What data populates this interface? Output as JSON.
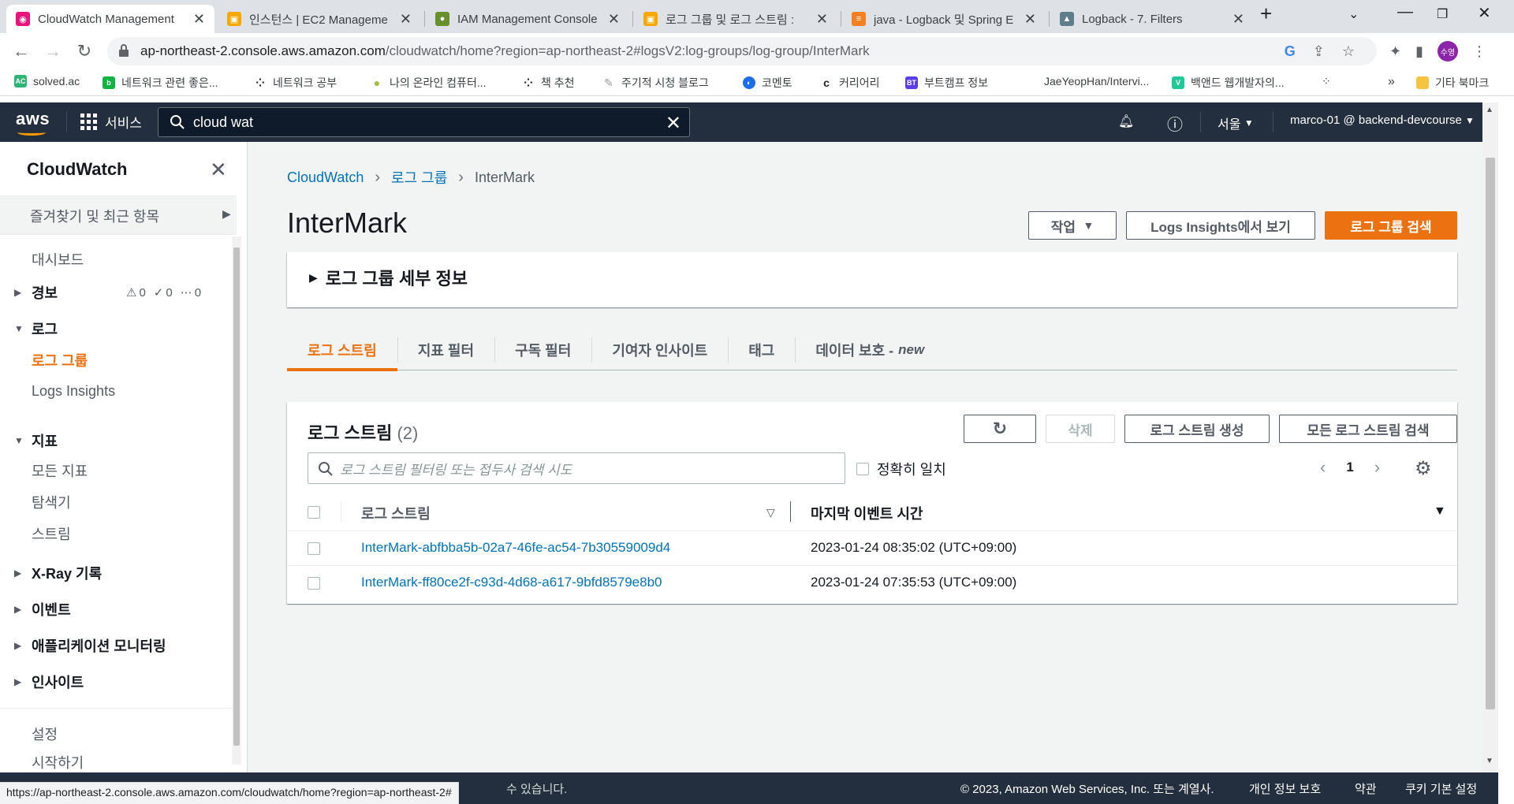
{
  "browser": {
    "tabs": [
      {
        "title": "CloudWatch Management",
        "active": true,
        "color": "#e7157b"
      },
      {
        "title": "인스턴스 | EC2 Manageme",
        "active": false,
        "color": "#f7a800"
      },
      {
        "title": "IAM Management Console",
        "active": false,
        "color": "#6a8f2e"
      },
      {
        "title": "로그 그룹 및 로그 스트림 :",
        "active": false,
        "color": "#f7a800"
      },
      {
        "title": "java - Logback 및 Spring E",
        "active": false,
        "color": "#f48024"
      },
      {
        "title": "Logback - 7. Filters",
        "active": false,
        "color": "#607d8b"
      }
    ],
    "url_host": "ap-northeast-2.console.aws.amazon.com",
    "url_path": "/cloudwatch/home?region=ap-northeast-2#logsV2:log-groups/log-group/InterMark",
    "profile_initial": "수영",
    "bookmarks": [
      {
        "label": "solved.ac",
        "color": "#2bb673",
        "icon": "AC"
      },
      {
        "label": "네트워크 관련 좋은...",
        "color": "#11b343",
        "icon": "b"
      },
      {
        "label": "네트워크 공부",
        "color": "#222222",
        "icon": "⁘"
      },
      {
        "label": "나의 온라인 컴퓨터...",
        "color": "#9ac43c",
        "icon": "●"
      },
      {
        "label": "책 추천",
        "color": "#222222",
        "icon": "⁘"
      },
      {
        "label": "주기적 시청 블로그",
        "color": "#999999",
        "icon": "✎"
      },
      {
        "label": "코멘토",
        "color": "#1c6ee8",
        "icon": "◐"
      },
      {
        "label": "커리어리",
        "color": "#222222",
        "icon": "c"
      },
      {
        "label": "부트캠프 정보",
        "color": "#5b3de8",
        "icon": "BT"
      },
      {
        "label": "JaeYeopHan/Intervi...",
        "color": "#ffffff",
        "icon": ""
      },
      {
        "label": "백앤드 웹개발자의...",
        "color": "#20c997",
        "icon": "V"
      },
      {
        "label": "기타 북마크",
        "color": "#f5c542",
        "icon": ""
      }
    ],
    "status_url": "https://ap-northeast-2.console.aws.amazon.com/cloudwatch/home?region=ap-northeast-2#"
  },
  "aws": {
    "logo": "aws",
    "services_label": "서비스",
    "search_value": "cloud wat",
    "region": "서울",
    "account": "marco-01 @ backend-devcourse"
  },
  "sidebar": {
    "title": "CloudWatch",
    "favorites": "즐겨찾기 및 최근 항목",
    "dashboard": "대시보드",
    "alarms": "경보",
    "alarm_counts": {
      "alarm": "0",
      "ok": "0",
      "insufficient": "0"
    },
    "logs": "로그",
    "log_groups": "로그 그룹",
    "logs_insights": "Logs Insights",
    "metrics": "지표",
    "all_metrics": "모든 지표",
    "explorer": "탐색기",
    "streams": "스트림",
    "xray": "X-Ray 기록",
    "events": "이벤트",
    "app_monitoring": "애플리케이션 모니터링",
    "insights": "인사이트",
    "settings": "설정",
    "getting_started": "시작하기"
  },
  "main": {
    "breadcrumbs": [
      "CloudWatch",
      "로그 그룹",
      "InterMark"
    ],
    "title": "InterMark",
    "actions_label": "작업",
    "view_insights_label": "Logs Insights에서 보기",
    "search_group_label": "로그 그룹 검색",
    "details_title": "로그 그룹 세부 정보",
    "tabs": [
      "로그 스트림",
      "지표 필터",
      "구독 필터",
      "기여자 인사이트",
      "태그",
      "데이터 보호 -"
    ],
    "tab_new": "new",
    "table_title": "로그 스트림",
    "table_count": "(2)",
    "delete_label": "삭제",
    "create_label": "로그 스트림 생성",
    "search_all_label": "모든 로그 스트림 검색",
    "filter_placeholder": "로그 스트림 필터링 또는 접두사 검색 시도",
    "exact_match": "정확히 일치",
    "page": "1",
    "columns": [
      "로그 스트림",
      "마지막 이벤트 시간"
    ],
    "rows": [
      {
        "stream": "InterMark-abfbba5b-02a7-46fe-ac54-7b30559009d4",
        "time": "2023-01-24 08:35:02 (UTC+09:00)"
      },
      {
        "stream": "InterMark-ff80ce2f-c93d-4d68-a617-9bfd8579e8b0",
        "time": "2023-01-24 07:35:53 (UTC+09:00)"
      }
    ]
  },
  "footer": {
    "partial_text": "수 있습니다.",
    "copyright": "© 2023, Amazon Web Services, Inc. 또는 계열사.",
    "privacy": "개인 정보 보호",
    "terms": "약관",
    "cookies": "쿠키 기본 설정"
  },
  "colors": {
    "aws_dark": "#232f3e",
    "accent": "#ec7211",
    "link": "#0073bb"
  }
}
